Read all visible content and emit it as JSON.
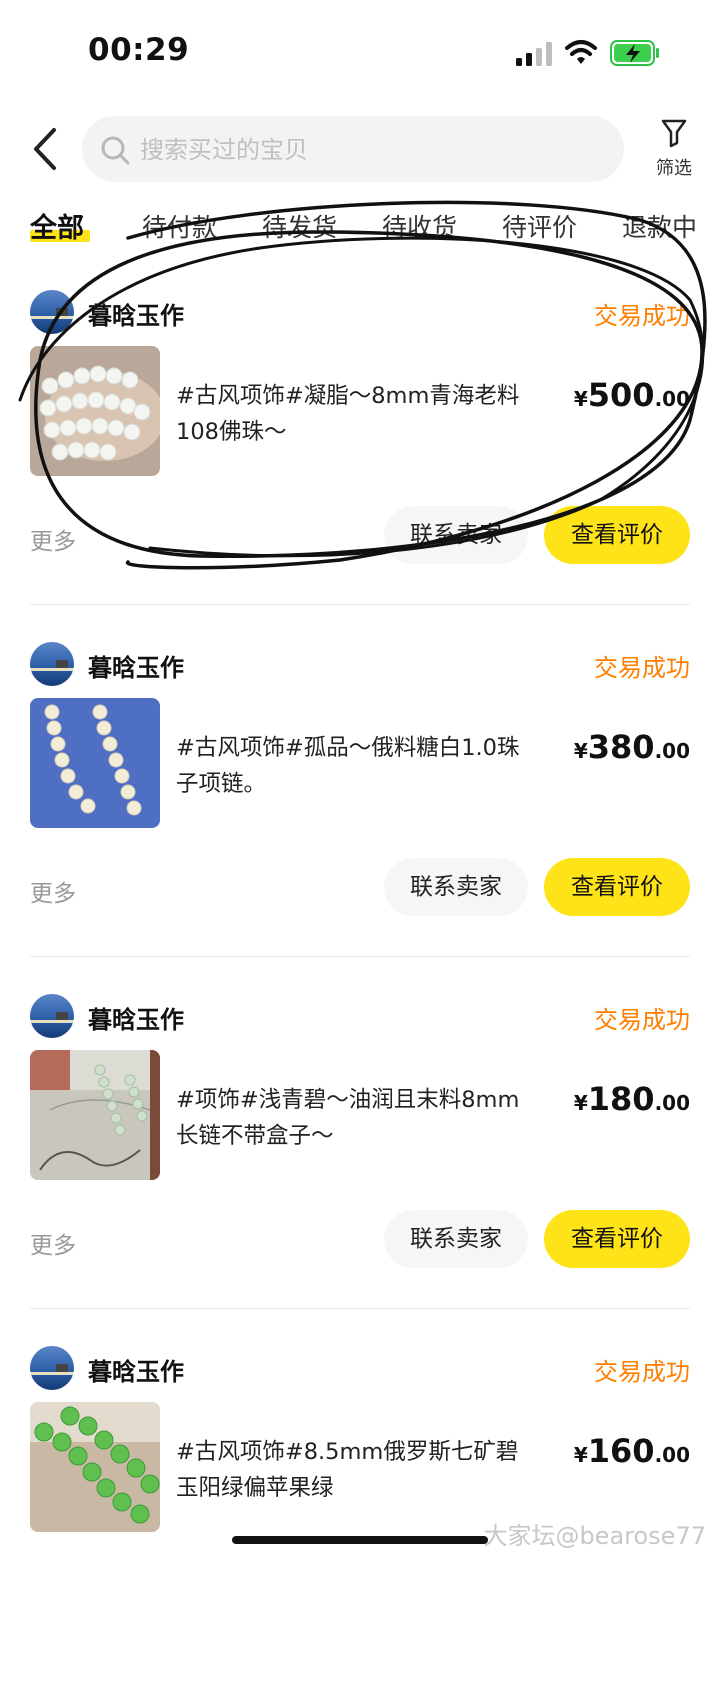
{
  "status_bar": {
    "time": "00:29"
  },
  "header": {
    "search_placeholder": "搜索买过的宝贝",
    "filter_label": "筛选"
  },
  "tabs": [
    {
      "label": "全部",
      "active": true
    },
    {
      "label": "待付款"
    },
    {
      "label": "待发货"
    },
    {
      "label": "待收货"
    },
    {
      "label": "待评价"
    },
    {
      "label": "退款中"
    }
  ],
  "orders": [
    {
      "shop_name": "暮晗玉作",
      "status": "交易成功",
      "title_line1": "#古风项饰#凝脂～8mm青海老料",
      "title_line2": "108佛珠～",
      "price_symbol": "¥",
      "price_int": "500",
      "price_dec": ".00",
      "more": "更多",
      "contact": "联系卖家",
      "review": "查看评价"
    },
    {
      "shop_name": "暮晗玉作",
      "status": "交易成功",
      "title_line1": "#古风项饰#孤品～俄料糖白1.0珠",
      "title_line2": "子项链。",
      "price_symbol": "¥",
      "price_int": "380",
      "price_dec": ".00",
      "more": "更多",
      "contact": "联系卖家",
      "review": "查看评价"
    },
    {
      "shop_name": "暮晗玉作",
      "status": "交易成功",
      "title_line1": "#项饰#浅青碧～油润且末料8mm",
      "title_line2": "长链不带盒子～",
      "price_symbol": "¥",
      "price_int": "180",
      "price_dec": ".00",
      "more": "更多",
      "contact": "联系卖家",
      "review": "查看评价"
    },
    {
      "shop_name": "暮晗玉作",
      "status": "交易成功",
      "title_line1": "#古风项饰#8.5mm俄罗斯七矿碧",
      "title_line2": "玉阳绿偏苹果绿",
      "price_symbol": "¥",
      "price_int": "160",
      "price_dec": ".00"
    }
  ],
  "watermark": "大家坛@bearose77",
  "colors": {
    "accent_yellow": "#ffe319",
    "status_orange": "#ff7f00"
  }
}
